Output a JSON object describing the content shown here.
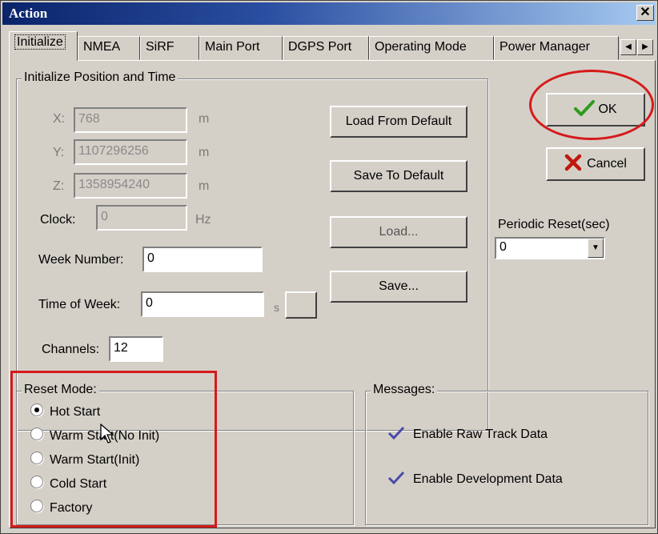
{
  "window": {
    "title": "Action",
    "close_label": "✕"
  },
  "tabs": [
    "Initialize",
    "NMEA",
    "SiRF",
    "Main Port",
    "DGPS Port",
    "Operating Mode",
    "Power Manager"
  ],
  "tab_scroll": {
    "left": "◀",
    "right": "▶"
  },
  "init_group": {
    "title": "Initialize Position and Time",
    "x_label": "X:",
    "x_value": "768",
    "x_unit": "m",
    "y_label": "Y:",
    "y_value": "1107296256",
    "y_unit": "m",
    "z_label": "Z:",
    "z_value": "1358954240",
    "z_unit": "m",
    "clock_label": "Clock:",
    "clock_value": "0",
    "clock_unit": "Hz",
    "week_label": "Week Number:",
    "week_value": "0",
    "tow_label": "Time of Week:",
    "tow_value": "0",
    "tow_unit": "s",
    "channels_label": "Channels:",
    "channels_value": "12"
  },
  "side_buttons": {
    "load_default": "Load From Default",
    "save_default": "Save To Default",
    "load": "Load...",
    "save": "Save..."
  },
  "dialog_buttons": {
    "ok": "OK",
    "cancel": "Cancel"
  },
  "periodic_reset": {
    "label": "Periodic Reset(sec)",
    "value": "0"
  },
  "reset_mode": {
    "title": "Reset Mode:",
    "options": [
      "Hot Start",
      "Warm Start(No Init)",
      "Warm Start(Init)",
      "Cold Start",
      "Factory"
    ],
    "selected": "Hot Start"
  },
  "messages": {
    "title": "Messages:",
    "items": [
      "Enable Raw Track Data",
      "Enable Development Data"
    ]
  },
  "colors": {
    "highlight": "#d61a1a",
    "title_bar": "#0a246a",
    "ok_check": "#2e9a1e",
    "cancel_x": "#c0170f"
  }
}
